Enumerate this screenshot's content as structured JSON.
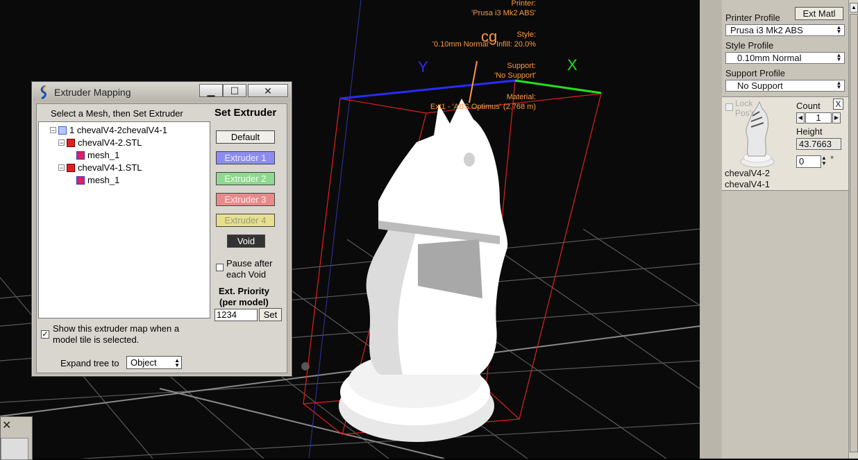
{
  "viewport": {
    "axis_labels": {
      "cg": "cg",
      "y": "Y",
      "x": "X"
    },
    "colors": {
      "info_text": "#ff9a3c",
      "axis_y": "#2a2aff",
      "axis_x": "#1fe01f",
      "axis_cg": "#ff9a3c",
      "bbox": "#ff2020",
      "grid": "#8a8a8a"
    },
    "info": {
      "printer_label": "Printer:",
      "printer_value": "'Prusa i3 Mk2 ABS'",
      "style_label": "Style:",
      "style_value": "'0.10mm Normal' - Infill: 20.0%",
      "support_label": "Support:",
      "support_value": "'No Support'",
      "material_label": "Material:",
      "material_value": "Ext1 - 'ABS Optimus' (2.768 m)"
    }
  },
  "dialog": {
    "title": "Extruder Mapping",
    "icon": "simplify3d-logo-icon",
    "minimize_label": "▁",
    "maximize_label": "☐",
    "close_label": "✕",
    "instruction": "Select a Mesh, then Set Extruder",
    "set_extruder_heading": "Set Extruder",
    "tree": [
      {
        "label": "1 chevalV4-2chevalV4-1",
        "level": 0,
        "expander": "−"
      },
      {
        "label": "chevalV4-2.STL",
        "level": 1,
        "expander": "−"
      },
      {
        "label": "mesh_1",
        "level": 2,
        "expander": ""
      },
      {
        "label": "chevalV4-1.STL",
        "level": 1,
        "expander": "−"
      },
      {
        "label": "mesh_1",
        "level": 2,
        "expander": ""
      }
    ],
    "buttons": {
      "default": "Default",
      "extruder1": "Extruder 1",
      "extruder2": "Extruder 2",
      "extruder3": "Extruder 3",
      "extruder4": "Extruder 4",
      "void": "Void"
    },
    "extruder_colors": {
      "e1": "#8c8cf0",
      "e2": "#8fd88f",
      "e3": "#e88a8a",
      "e4": "#e6e08a"
    },
    "pause_after_void": {
      "line1": "Pause after",
      "line2": "each Void",
      "checked": false
    },
    "ext_priority": {
      "label1": "Ext. Priority",
      "label2": "(per model)",
      "value": "1234",
      "set_label": "Set"
    },
    "show_map": {
      "line1": "Show this extruder map when a",
      "line2": "model tile is selected.",
      "checked": true
    },
    "expand_tree": {
      "label": "Expand tree to",
      "value": "Object"
    }
  },
  "sidebar": {
    "ext_matl_label": "Ext Matl",
    "printer_profile_label": "Printer Profile",
    "printer_profile_value": "Prusa i3 Mk2 ABS",
    "style_profile_label": "Style Profile",
    "style_profile_value": "0.10mm Normal",
    "support_profile_label": "Support Profile",
    "support_profile_value": "No Support",
    "tile": {
      "lock_label": "Lock",
      "lock_label2": "Pos'n",
      "close_label": "X",
      "count_label": "Count",
      "count_value": "1",
      "height_label": "Height",
      "height_value": "43.7663",
      "rotation_value": "0",
      "degree": "°",
      "name_line1": "chevalV4-2",
      "name_line2": "chevalV4-1"
    }
  },
  "bottom_left": {
    "close_label": "✕"
  }
}
